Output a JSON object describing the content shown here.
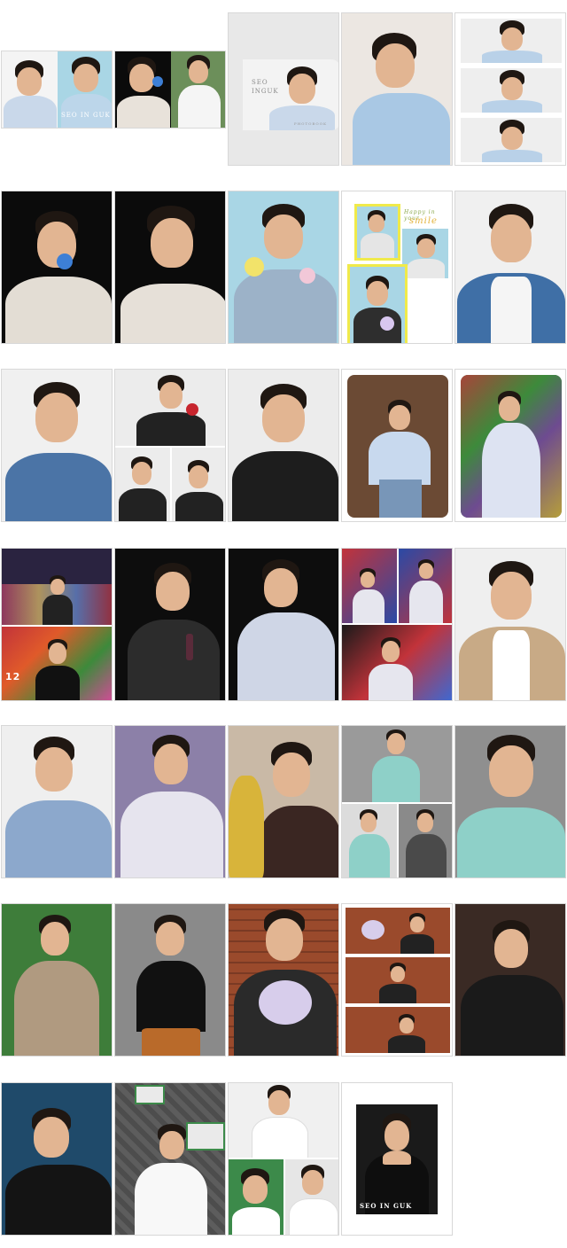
{
  "card_texts": {
    "seo_inguk_logo": "SEO IN GUK",
    "seo_inguk_title_line1": "SEO",
    "seo_inguk_title_line2": "INGUK",
    "photobook_label": "PHOTOBOOK",
    "happy_in_your": "Happy in your",
    "smile": "smile",
    "seo_in_guk_final": "SEO IN GUK",
    "stage_number": "12"
  },
  "colors": {
    "card_border": "#d8d8d8",
    "sky_blue": "#a9d6e5",
    "black_bg": "#0b0b0b",
    "stage_red": "#c2333a",
    "stage_green": "#3d8a3b",
    "lavender": "#8c80a8",
    "olive_green": "#3e7d3a",
    "brick": "#9a4a2c",
    "stone_gray": "#5d5d5d"
  }
}
